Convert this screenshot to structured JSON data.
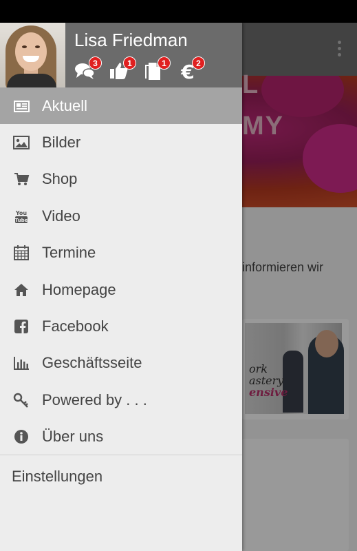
{
  "user": {
    "name": "Lisa Friedman",
    "badges": {
      "messages": "3",
      "likes": "1",
      "documents": "1",
      "payments": "2"
    }
  },
  "menu": {
    "items": [
      {
        "label": "Aktuell",
        "icon": "newspaper-icon",
        "active": true
      },
      {
        "label": "Bilder",
        "icon": "image-icon"
      },
      {
        "label": "Shop",
        "icon": "cart-icon"
      },
      {
        "label": "Video",
        "icon": "youtube-icon"
      },
      {
        "label": "Termine",
        "icon": "calendar-icon"
      },
      {
        "label": "Homepage",
        "icon": "home-icon"
      },
      {
        "label": "Facebook",
        "icon": "facebook-icon"
      },
      {
        "label": "Geschäftsseite",
        "icon": "bar-chart-icon"
      },
      {
        "label": "Powered by . . .",
        "icon": "key-icon"
      },
      {
        "label": "Über uns",
        "icon": "info-icon"
      }
    ],
    "settings_label": "Einstellungen"
  },
  "background": {
    "banner_text": "L\nMY",
    "body_text": "informieren wir",
    "card_text_1": "ork",
    "card_text_2": "astery",
    "card_text_3": "ensive"
  },
  "colors": {
    "header_bg": "#6b6b6b",
    "active_bg": "#a4a4a4",
    "badge": "#e02020",
    "drawer_bg": "#ededed"
  }
}
